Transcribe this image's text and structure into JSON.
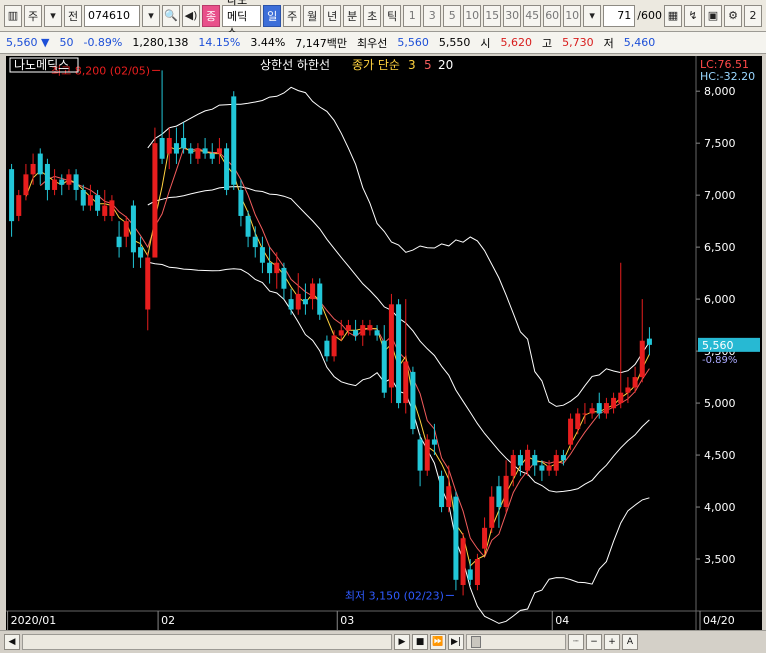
{
  "toolbar": {
    "period_type": "주",
    "prev_label": "전",
    "code": "074610",
    "stock_name": "나노메딕스",
    "tabs": [
      "일",
      "주",
      "월",
      "년",
      "분",
      "초",
      "틱"
    ],
    "selected_tab": "일",
    "intervals": [
      "1",
      "3",
      "5",
      "10",
      "15",
      "30",
      "45",
      "60"
    ],
    "interval_select": "10",
    "counter": "71",
    "counter_total": "/600",
    "right_edge": "2"
  },
  "info": {
    "price": "5,560",
    "change": "50",
    "change_pct": "-0.89%",
    "volume": "1,280,138",
    "turnover_pct": "14.15%",
    "ratio": "3.44%",
    "amount": "7,147백만",
    "ask_label": "최우선",
    "ask": "5,560",
    "bid": "5,550",
    "open_label": "시",
    "open": "5,620",
    "high_label": "고",
    "high": "5,730",
    "low_label": "저",
    "low": "5,460"
  },
  "legend": {
    "stock_name": "나노메딕스",
    "band_label": "상한선 하한선",
    "ma_label": "종가 단순",
    "ma_periods": [
      "3",
      "5",
      "20"
    ],
    "lc": "LC:76.51",
    "hc": "HC:-32.20"
  },
  "annotations": {
    "high_note": "최고 8,200 (02/05)",
    "low_note": "최저 3,150 (02/23)",
    "current_price": "5,560",
    "current_pct": "-0.89%"
  },
  "colors": {
    "up": "#e81e1e",
    "down": "#22c7d8",
    "ma3": "#ffd23f",
    "ma5": "#f25c5c",
    "ma20": "#ffffff",
    "band": "#ffffff",
    "price_tag": "#27b9d3"
  },
  "chart_data": {
    "type": "candlestick",
    "y_axis_ticks": [
      "8,000",
      "7,500",
      "7,000",
      "6,500",
      "6,000",
      "5,500",
      "5,000",
      "4,500",
      "4,000",
      "3,500"
    ],
    "y_axis_values": [
      8000,
      7500,
      7000,
      6500,
      6000,
      5500,
      5000,
      4500,
      4000,
      3500
    ],
    "ylim": [
      3000,
      8300
    ],
    "x_axis_ticks": [
      "2020/01",
      "02",
      "03",
      "04",
      "04/20"
    ],
    "x_axis_positions": [
      0,
      21,
      46,
      76,
      101
    ],
    "candles": [
      {
        "o": 7250,
        "c": 6750,
        "h": 7300,
        "l": 6600
      },
      {
        "o": 6800,
        "c": 7000,
        "h": 7050,
        "l": 6750
      },
      {
        "o": 7000,
        "c": 7200,
        "h": 7300,
        "l": 6950
      },
      {
        "o": 7200,
        "c": 7300,
        "h": 7400,
        "l": 7100
      },
      {
        "o": 7400,
        "c": 7200,
        "h": 7450,
        "l": 7100
      },
      {
        "o": 7300,
        "c": 7050,
        "h": 7350,
        "l": 6950
      },
      {
        "o": 7050,
        "c": 7150,
        "h": 7250,
        "l": 7000
      },
      {
        "o": 7150,
        "c": 7100,
        "h": 7200,
        "l": 7000
      },
      {
        "o": 7100,
        "c": 7200,
        "h": 7250,
        "l": 7050
      },
      {
        "o": 7200,
        "c": 7050,
        "h": 7250,
        "l": 6950
      },
      {
        "o": 7050,
        "c": 6900,
        "h": 7100,
        "l": 6850
      },
      {
        "o": 6900,
        "c": 7000,
        "h": 7100,
        "l": 6850
      },
      {
        "o": 7000,
        "c": 6850,
        "h": 7050,
        "l": 6800
      },
      {
        "o": 6800,
        "c": 6900,
        "h": 7050,
        "l": 6750
      },
      {
        "o": 6800,
        "c": 6950,
        "h": 7000,
        "l": 6750
      },
      {
        "o": 6600,
        "c": 6500,
        "h": 6750,
        "l": 6400
      },
      {
        "o": 6600,
        "c": 6750,
        "h": 6800,
        "l": 6500
      },
      {
        "o": 6900,
        "c": 6450,
        "h": 6950,
        "l": 6300
      },
      {
        "o": 6500,
        "c": 6400,
        "h": 6600,
        "l": 6300
      },
      {
        "o": 5900,
        "c": 6400,
        "h": 6450,
        "l": 5700
      },
      {
        "o": 6400,
        "c": 7500,
        "h": 7650,
        "l": 6400
      },
      {
        "o": 7550,
        "c": 7350,
        "h": 8200,
        "l": 7300
      },
      {
        "o": 7400,
        "c": 7550,
        "h": 7650,
        "l": 7250
      },
      {
        "o": 7500,
        "c": 7400,
        "h": 7650,
        "l": 7300
      },
      {
        "o": 7550,
        "c": 7450,
        "h": 7700,
        "l": 7400
      },
      {
        "o": 7450,
        "c": 7400,
        "h": 7500,
        "l": 7300
      },
      {
        "o": 7350,
        "c": 7450,
        "h": 7500,
        "l": 7300
      },
      {
        "o": 7450,
        "c": 7400,
        "h": 7550,
        "l": 7350
      },
      {
        "o": 7400,
        "c": 7350,
        "h": 7500,
        "l": 7300
      },
      {
        "o": 7400,
        "c": 7450,
        "h": 7550,
        "l": 7300
      },
      {
        "o": 7450,
        "c": 7050,
        "h": 7500,
        "l": 7000
      },
      {
        "o": 7950,
        "c": 7100,
        "h": 8000,
        "l": 7050
      },
      {
        "o": 7050,
        "c": 6800,
        "h": 7150,
        "l": 6700
      },
      {
        "o": 6800,
        "c": 6600,
        "h": 6850,
        "l": 6500
      },
      {
        "o": 6600,
        "c": 6500,
        "h": 6700,
        "l": 6400
      },
      {
        "o": 6500,
        "c": 6350,
        "h": 6600,
        "l": 6250
      },
      {
        "o": 6350,
        "c": 6250,
        "h": 6500,
        "l": 6150
      },
      {
        "o": 6250,
        "c": 6350,
        "h": 6450,
        "l": 6100
      },
      {
        "o": 6300,
        "c": 6100,
        "h": 6350,
        "l": 6000
      },
      {
        "o": 6000,
        "c": 5900,
        "h": 6100,
        "l": 5850
      },
      {
        "o": 5900,
        "c": 6050,
        "h": 6250,
        "l": 5850
      },
      {
        "o": 6000,
        "c": 5950,
        "h": 6150,
        "l": 5850
      },
      {
        "o": 6000,
        "c": 6150,
        "h": 6200,
        "l": 5900
      },
      {
        "o": 6150,
        "c": 5850,
        "h": 6200,
        "l": 5800
      },
      {
        "o": 5600,
        "c": 5450,
        "h": 5650,
        "l": 5400
      },
      {
        "o": 5450,
        "c": 5650,
        "h": 5700,
        "l": 5400
      },
      {
        "o": 5650,
        "c": 5700,
        "h": 5800,
        "l": 5600
      },
      {
        "o": 5700,
        "c": 5750,
        "h": 5800,
        "l": 5650
      },
      {
        "o": 5700,
        "c": 5650,
        "h": 5800,
        "l": 5600
      },
      {
        "o": 5650,
        "c": 5750,
        "h": 5800,
        "l": 5550
      },
      {
        "o": 5700,
        "c": 5750,
        "h": 5800,
        "l": 5650
      },
      {
        "o": 5700,
        "c": 5650,
        "h": 5750,
        "l": 5600
      },
      {
        "o": 5600,
        "c": 5100,
        "h": 5750,
        "l": 5050
      },
      {
        "o": 5150,
        "c": 5950,
        "h": 6050,
        "l": 5000
      },
      {
        "o": 5950,
        "c": 5000,
        "h": 6000,
        "l": 4950
      },
      {
        "o": 5000,
        "c": 5400,
        "h": 6000,
        "l": 4900
      },
      {
        "o": 5300,
        "c": 4750,
        "h": 5350,
        "l": 4700
      },
      {
        "o": 4650,
        "c": 4350,
        "h": 4700,
        "l": 4200
      },
      {
        "o": 4350,
        "c": 4650,
        "h": 4700,
        "l": 4300
      },
      {
        "o": 4650,
        "c": 4600,
        "h": 4800,
        "l": 4500
      },
      {
        "o": 4300,
        "c": 4000,
        "h": 4350,
        "l": 3950
      },
      {
        "o": 4000,
        "c": 4200,
        "h": 4400,
        "l": 3950
      },
      {
        "o": 4100,
        "c": 3300,
        "h": 4150,
        "l": 3200
      },
      {
        "o": 3250,
        "c": 3700,
        "h": 3750,
        "l": 3150
      },
      {
        "o": 3400,
        "c": 3300,
        "h": 3500,
        "l": 3250
      },
      {
        "o": 3250,
        "c": 3500,
        "h": 3550,
        "l": 3200
      },
      {
        "o": 3600,
        "c": 3800,
        "h": 3900,
        "l": 3550
      },
      {
        "o": 3800,
        "c": 4100,
        "h": 4200,
        "l": 3750
      },
      {
        "o": 4200,
        "c": 4000,
        "h": 4300,
        "l": 3800
      },
      {
        "o": 4000,
        "c": 4300,
        "h": 4450,
        "l": 3950
      },
      {
        "o": 4300,
        "c": 4500,
        "h": 4550,
        "l": 4200
      },
      {
        "o": 4500,
        "c": 4400,
        "h": 4550,
        "l": 4300
      },
      {
        "o": 4350,
        "c": 4550,
        "h": 4600,
        "l": 4300
      },
      {
        "o": 4500,
        "c": 4400,
        "h": 4550,
        "l": 4300
      },
      {
        "o": 4400,
        "c": 4350,
        "h": 4450,
        "l": 4250
      },
      {
        "o": 4350,
        "c": 4400,
        "h": 4450,
        "l": 4300
      },
      {
        "o": 4350,
        "c": 4500,
        "h": 4550,
        "l": 4300
      },
      {
        "o": 4500,
        "c": 4450,
        "h": 4550,
        "l": 4400
      },
      {
        "o": 4600,
        "c": 4850,
        "h": 4900,
        "l": 4550
      },
      {
        "o": 4750,
        "c": 4900,
        "h": 4950,
        "l": 4700
      },
      {
        "o": 4900,
        "c": 4900,
        "h": 5000,
        "l": 4800
      },
      {
        "o": 4900,
        "c": 4950,
        "h": 5000,
        "l": 4850
      },
      {
        "o": 5000,
        "c": 4900,
        "h": 5100,
        "l": 4850
      },
      {
        "o": 4900,
        "c": 5000,
        "h": 5050,
        "l": 4850
      },
      {
        "o": 4950,
        "c": 5050,
        "h": 5100,
        "l": 4900
      },
      {
        "o": 5000,
        "c": 5100,
        "h": 6350,
        "l": 4950
      },
      {
        "o": 5100,
        "c": 5150,
        "h": 5250,
        "l": 5000
      },
      {
        "o": 5150,
        "c": 5250,
        "h": 5350,
        "l": 5100
      },
      {
        "o": 5250,
        "c": 5600,
        "h": 6000,
        "l": 5200
      },
      {
        "o": 5620,
        "c": 5560,
        "h": 5730,
        "l": 5460
      }
    ],
    "high_marker": {
      "index": 21,
      "value": 8200,
      "label": "최고 8,200 (02/05)"
    },
    "low_marker": {
      "index": 62,
      "value": 3150,
      "label": "최저 3,150 (02/23)"
    }
  }
}
